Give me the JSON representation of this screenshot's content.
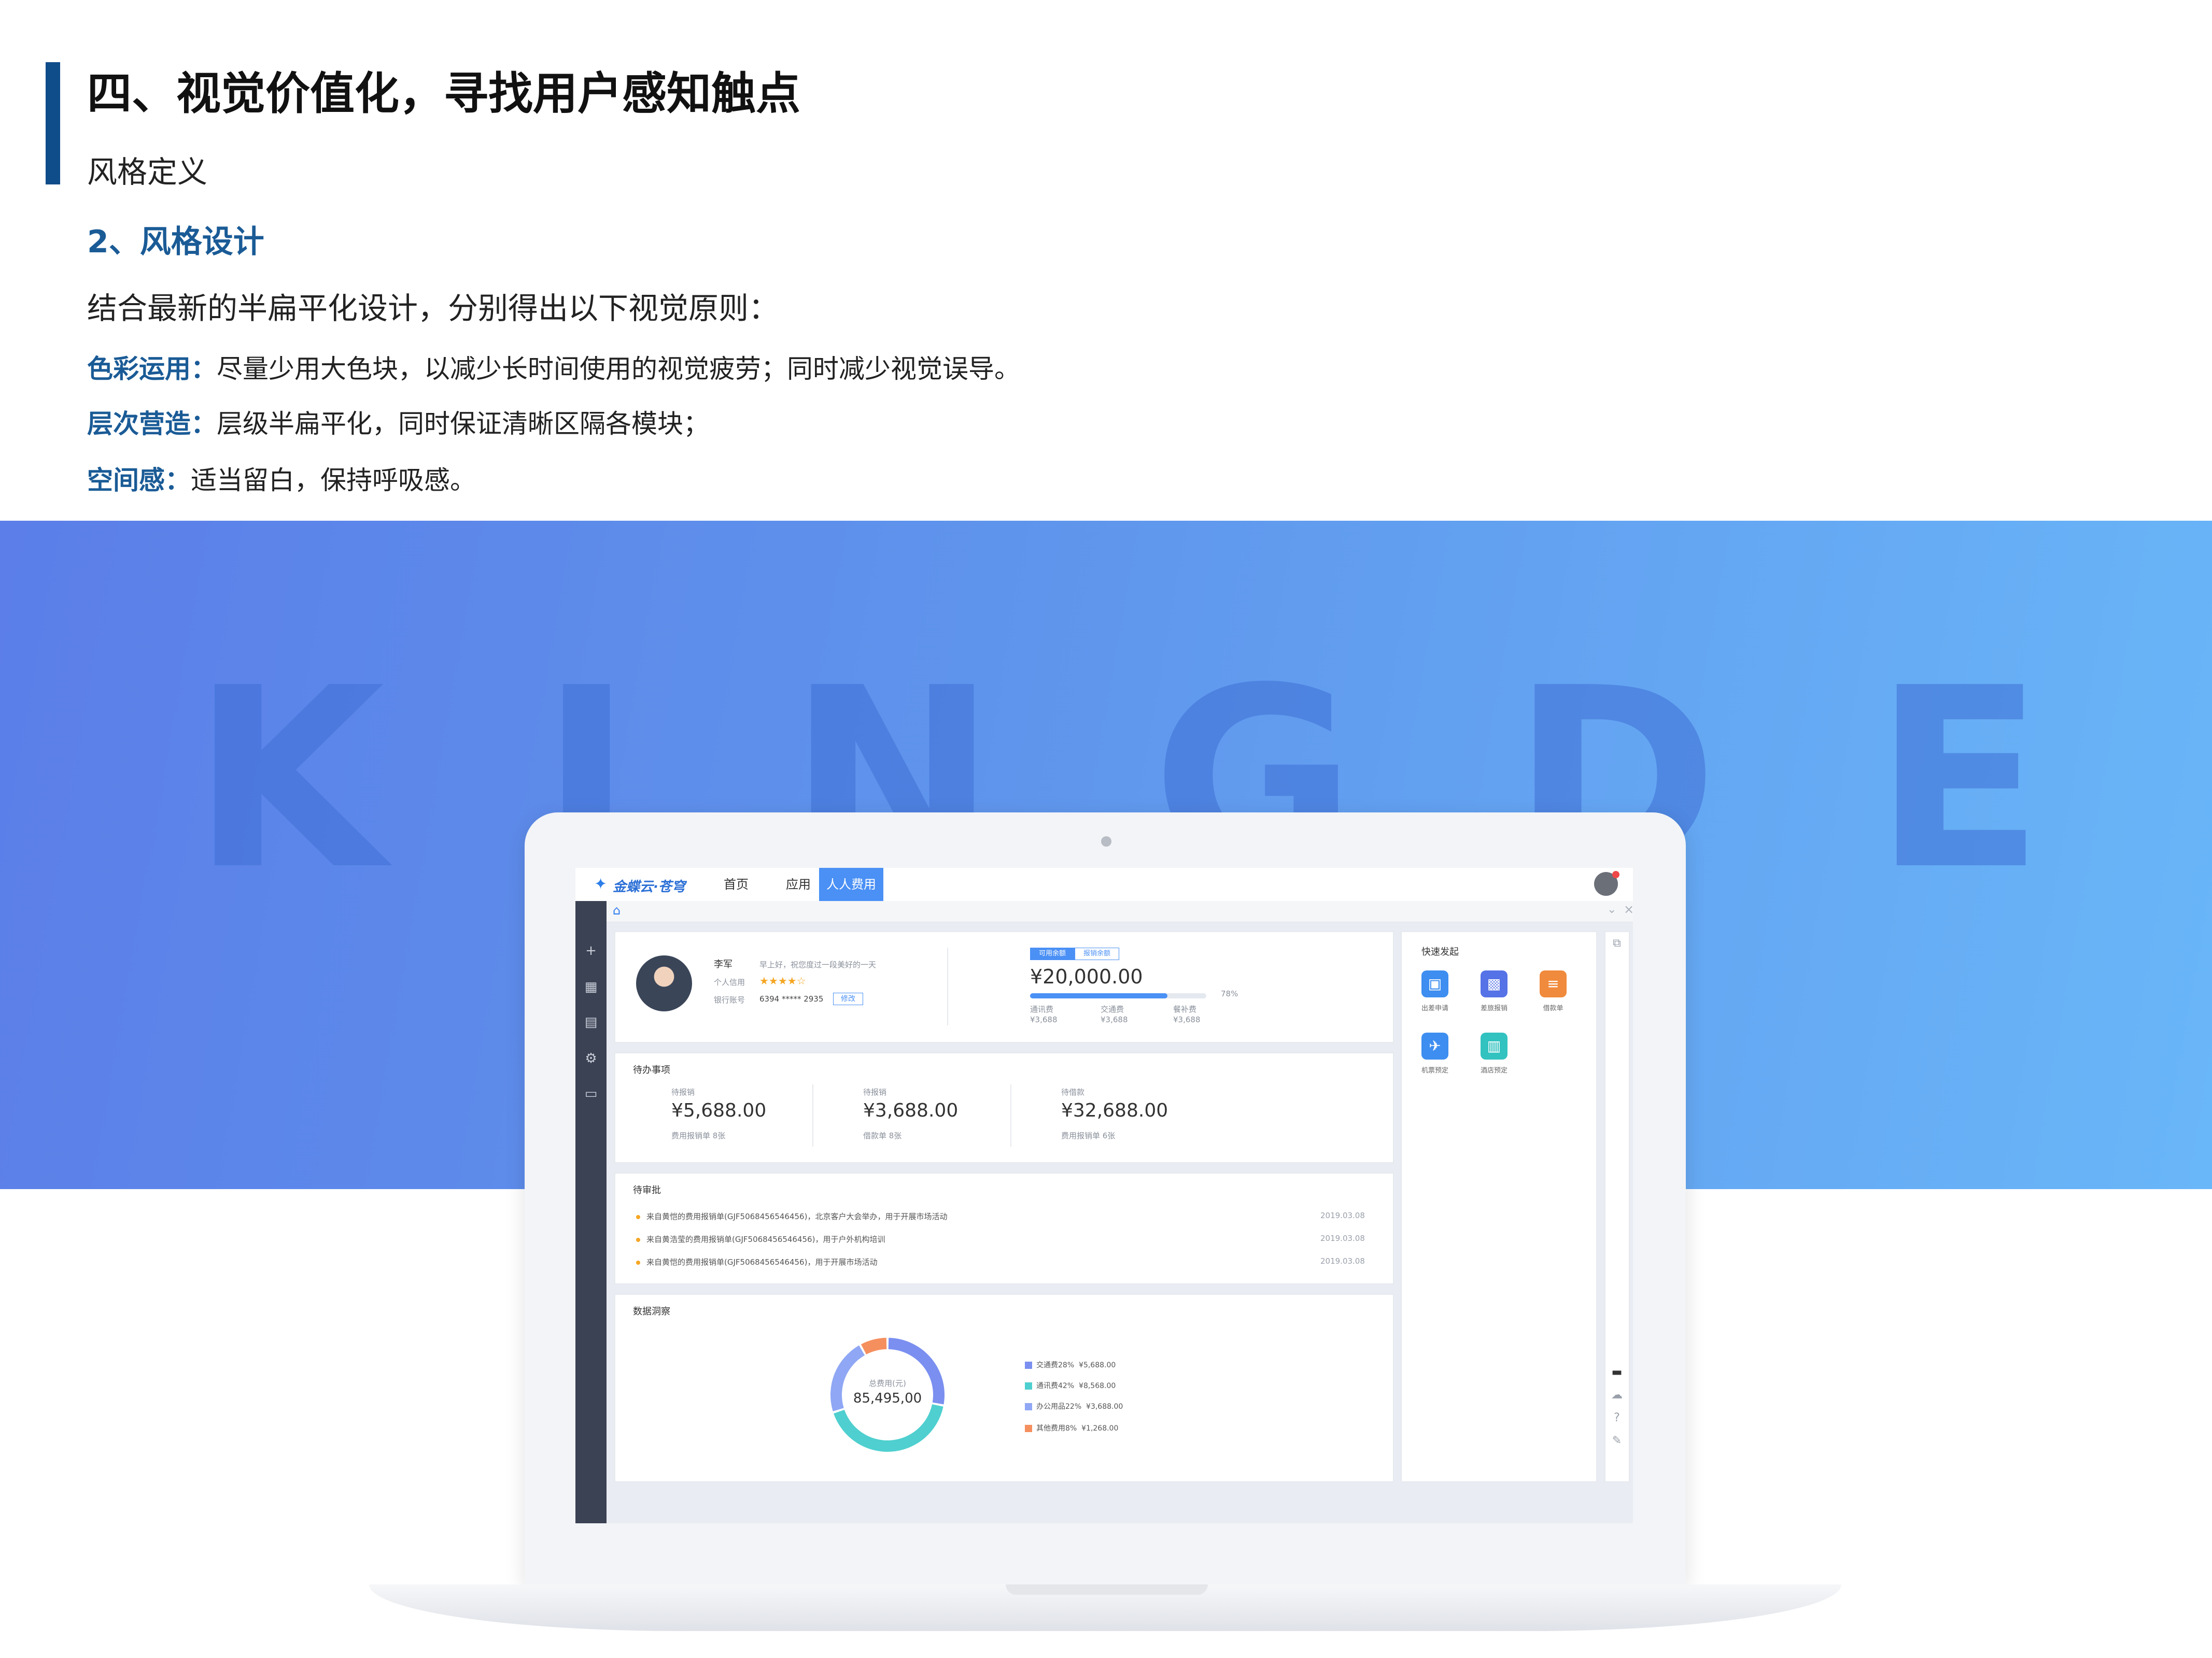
{
  "header": {
    "title": "四、视觉价值化，寻找用户感知触点",
    "subtitle": "风格定义",
    "section_heading": "2、风格设计",
    "intro": "结合最新的半扁平化设计，分别得出以下视觉原则："
  },
  "principles": [
    {
      "label": "色彩运用：",
      "text": "尽量少用大色块，以减少长时间使用的视觉疲劳；同时减少视觉误导。"
    },
    {
      "label": "层次营造：",
      "text": "层级半扁平化，同时保证清晰区隔各模块；"
    },
    {
      "label": "空间感：",
      "text": "适当留白，保持呼吸感。"
    }
  ],
  "banner": {
    "word": "KINGDEE"
  },
  "colors": {
    "accent": "#1a5b96",
    "primary": "#4a90f5",
    "banner_start": "#5b7ee8",
    "banner_end": "#69b6f8",
    "sidebar": "#3b4254"
  },
  "app": {
    "logo": "金蝶云·苍穹",
    "nav": [
      "首页",
      "应用",
      "人人费用"
    ],
    "active_nav": "人人费用",
    "sidebar_icons": [
      "plus-icon",
      "grid-icon",
      "document-icon",
      "gear-icon",
      "card-icon"
    ],
    "profile": {
      "name": "李军",
      "greeting": "早上好，祝您度过一段美好的一天",
      "credit_label": "个人信用",
      "credit_rating": 4,
      "credit_stars": "★★★★☆",
      "bank_label": "银行账号",
      "bank_number": "6394 ***** 2935",
      "bank_edit": "修改"
    },
    "quota": {
      "tabs": [
        "可用余额",
        "报销余额"
      ],
      "amount": "¥20,000.00",
      "progress_percent": 78,
      "progress_label": "78%",
      "items": [
        {
          "label": "通讯费",
          "value": "¥3,688"
        },
        {
          "label": "交通费",
          "value": "¥3,688"
        },
        {
          "label": "餐补费",
          "value": "¥3,688"
        }
      ]
    },
    "todo": {
      "title": "待办事项",
      "items": [
        {
          "label": "待报销",
          "value": "¥5,688.00",
          "sub": "费用报销单  8张"
        },
        {
          "label": "待报销",
          "value": "¥3,688.00",
          "sub": "借款单  8张"
        },
        {
          "label": "待借款",
          "value": "¥32,688.00",
          "sub": "费用报销单  6张"
        }
      ]
    },
    "approval": {
      "title": "待审批",
      "items": [
        {
          "text": "来自黄恺的费用报销单(GJF5068456546456)，北京客户大会举办，用于开展市场活动",
          "date": "2019.03.08"
        },
        {
          "text": "来自黄浩莹的费用报销单(GJF5068456546456)，用于户外机构培训",
          "date": "2019.03.08"
        },
        {
          "text": "来自黄恺的费用报销单(GJF5068456546456)，用于开展市场活动",
          "date": "2019.03.08"
        }
      ]
    },
    "data_insight": {
      "title": "数据洞察",
      "total_label": "总费用(元)",
      "total_value": "85,495,00",
      "legend": [
        {
          "label": "交通费28%",
          "value": "¥5,688.00",
          "color": "#7b8ff0",
          "percent": 28
        },
        {
          "label": "通讯费42%",
          "value": "¥8,568.00",
          "color": "#4fcfcf",
          "percent": 42
        },
        {
          "label": "办公用品22%",
          "value": "¥3,688.00",
          "color": "#8fa7f4",
          "percent": 22
        },
        {
          "label": "其他费用8%",
          "value": "¥1,268.00",
          "color": "#f58f5e",
          "percent": 8
        }
      ]
    },
    "quick_actions": {
      "title": "快速发起",
      "items": [
        {
          "label": "出差申请",
          "icon": "luggage-icon",
          "color": "#3d8ef0"
        },
        {
          "label": "差旅报销",
          "icon": "screen-icon",
          "color": "#5572e6"
        },
        {
          "label": "借款单",
          "icon": "document-icon",
          "color": "#f08a3c"
        },
        {
          "label": "机票预定",
          "icon": "plane-icon",
          "color": "#3d8ef0"
        },
        {
          "label": "酒店预定",
          "icon": "hotel-icon",
          "color": "#32c2c0"
        }
      ]
    }
  }
}
